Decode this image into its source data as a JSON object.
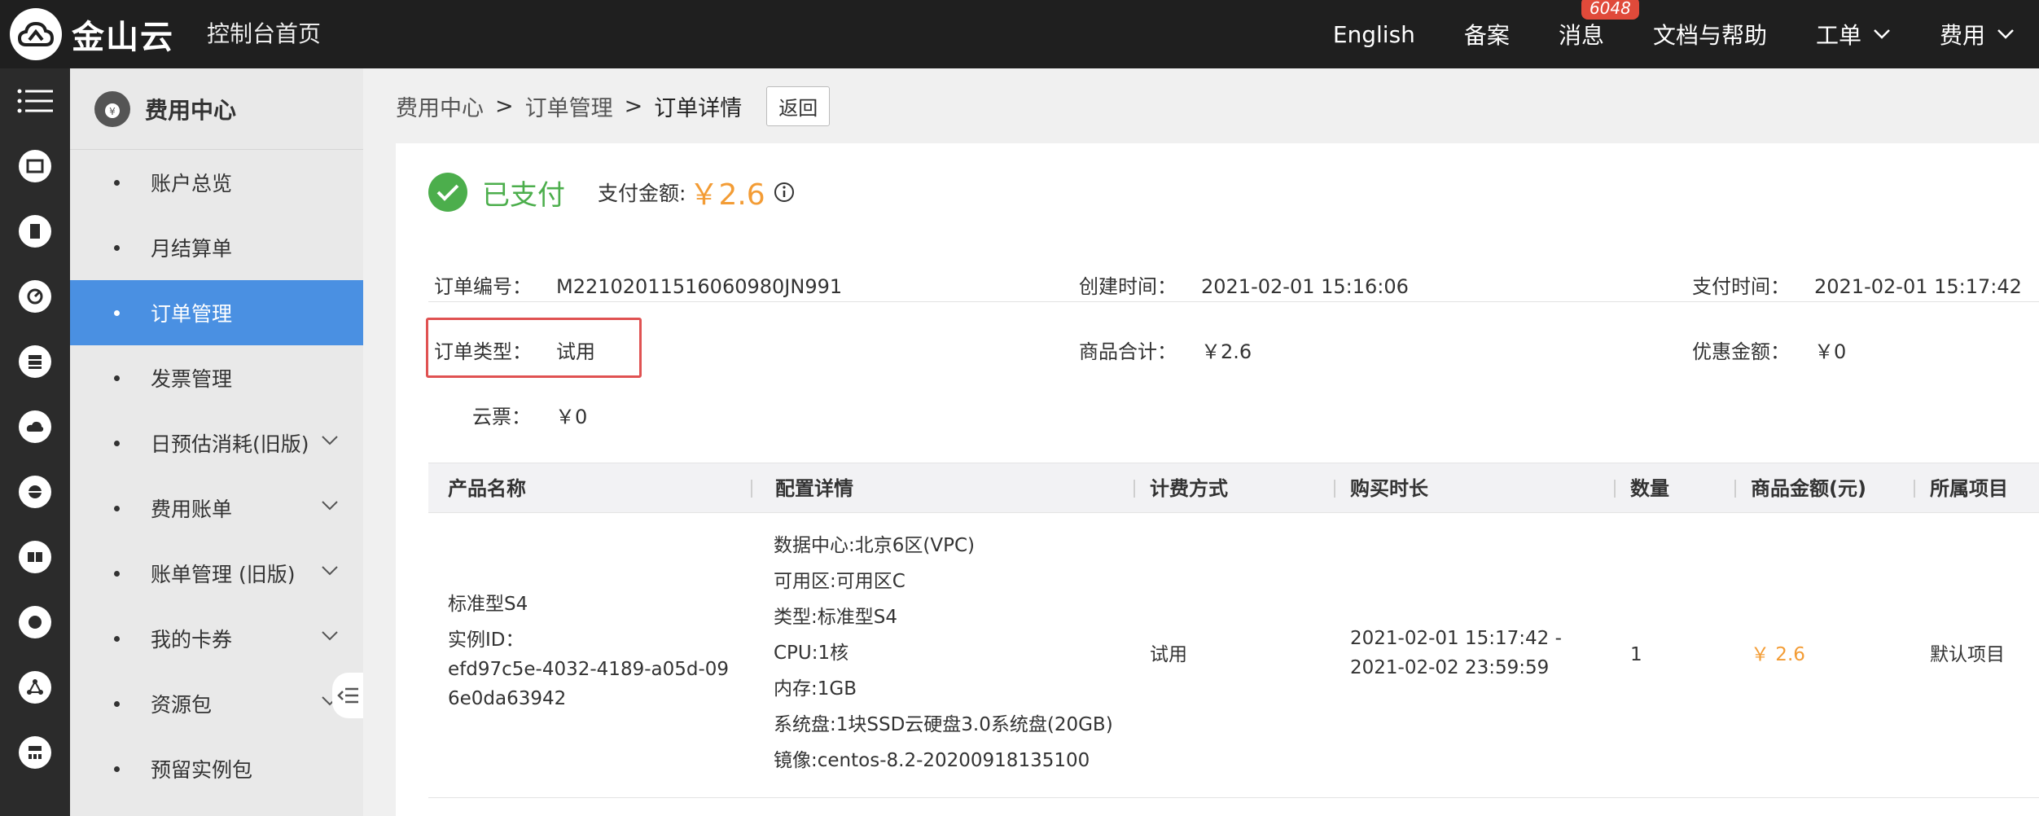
{
  "brand": {
    "name": "金山云"
  },
  "header": {
    "console_home": "控制台首页",
    "nav": [
      {
        "label": "English"
      },
      {
        "label": "备案"
      },
      {
        "label": "消息",
        "badge": "6048"
      },
      {
        "label": "文档与帮助"
      },
      {
        "label": "工单"
      },
      {
        "label": "费用"
      }
    ]
  },
  "sidebar": {
    "title": "费用中心",
    "items": [
      {
        "label": "账户总览"
      },
      {
        "label": "月结算单"
      },
      {
        "label": "订单管理",
        "active": true
      },
      {
        "label": "发票管理"
      },
      {
        "label": "日预估消耗(旧版)"
      },
      {
        "label": "费用账单"
      },
      {
        "label": "账单管理 (旧版)"
      },
      {
        "label": "我的卡券"
      },
      {
        "label": "资源包"
      },
      {
        "label": "预留实例包"
      }
    ]
  },
  "breadcrumb": {
    "items": [
      "费用中心",
      "订单管理",
      "订单详情"
    ],
    "separator": ">",
    "back_label": "返回"
  },
  "order": {
    "status": "已支付",
    "pay_amount_label": "支付金额:",
    "pay_amount": "￥2.6",
    "fields": {
      "order_no": {
        "label": "订单编号：",
        "value": "M22102011516060980JN991"
      },
      "created": {
        "label": "创建时间：",
        "value": "2021-02-01 15:16:06"
      },
      "paid": {
        "label": "支付时间：",
        "value": "2021-02-01 15:17:42"
      },
      "type": {
        "label": "订单类型：",
        "value": "试用"
      },
      "goods_total": {
        "label": "商品合计：",
        "value": "￥2.6"
      },
      "discount": {
        "label": "优惠金额：",
        "value": "￥0"
      },
      "cloud_ticket": {
        "label": "云票：",
        "value": "￥0"
      }
    }
  },
  "table": {
    "columns": [
      "产品名称",
      "配置详情",
      "计费方式",
      "购买时长",
      "数量",
      "商品金额(元)",
      "所属项目"
    ],
    "rows": [
      {
        "product": "标准型S4",
        "instance_label": "实例ID：",
        "instance_id_1": "efd97c5e-4032-4189-a05d-09",
        "instance_id_2": "6e0da63942",
        "config": [
          "数据中心:北京6区(VPC)",
          "可用区:可用区C",
          "类型:标准型S4",
          "CPU:1核",
          "内存:1GB",
          "系统盘:1块SSD云硬盘3.0系统盘(20GB)",
          "镜像:centos-8.2-20200918135100"
        ],
        "billing": "试用",
        "duration_start": "2021-02-01 15:17:42 -",
        "duration_end": "2021-02-02 23:59:59",
        "quantity": "1",
        "amount": "￥ 2.6",
        "project": "默认项目"
      }
    ]
  },
  "colors": {
    "accent": "#4a90e2",
    "success": "#4cae4c",
    "price": "#f39c35",
    "highlight": "#e05252"
  }
}
